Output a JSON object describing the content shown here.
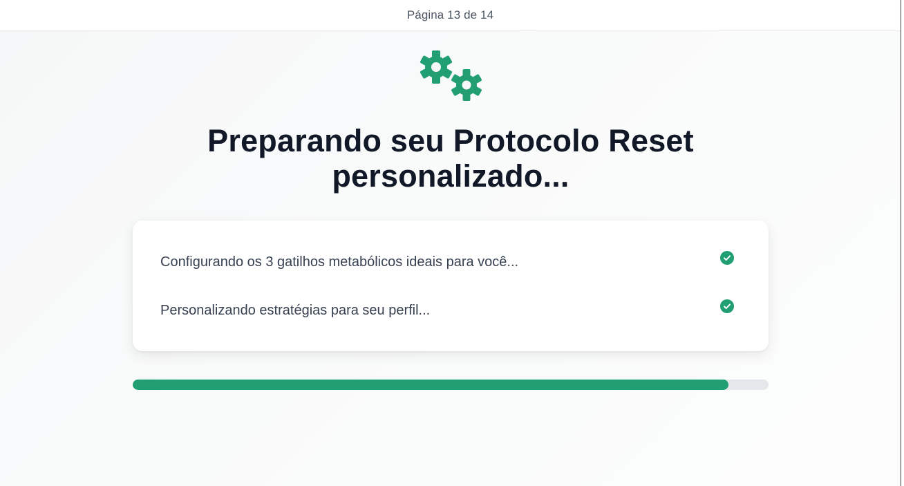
{
  "header": {
    "page_indicator": "Página 13 de 14"
  },
  "hero": {
    "icon": "gears-icon",
    "title": "Preparando seu Protocolo Reset personalizado..."
  },
  "steps": [
    {
      "label": "Configurando os 3 gatilhos metabólicos ideais para você...",
      "status": "done",
      "icon": "check-circle-icon"
    },
    {
      "label": "Personalizando estratégias para seu perfil...",
      "status": "done",
      "icon": "check-circle-icon"
    }
  ],
  "progress": {
    "value": 0.937
  },
  "colors": {
    "accent": "#229f72",
    "title": "#111827",
    "text": "#374151",
    "track": "#e5e7eb"
  }
}
